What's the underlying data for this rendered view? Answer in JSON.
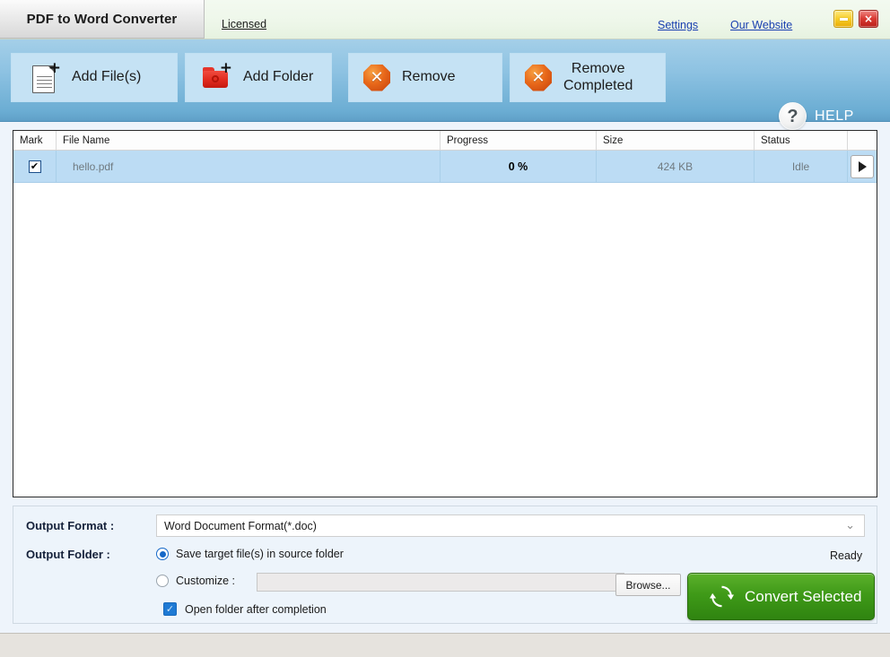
{
  "window": {
    "title": "PDF to Word Converter",
    "license_link": "Licensed",
    "settings_link": "Settings",
    "website_link": "Our Website",
    "minimize_glyph": "minimize-icon",
    "close_glyph": "×"
  },
  "toolbar": {
    "add_files": "Add File(s)",
    "add_folder": "Add Folder",
    "remove": "Remove",
    "remove_completed_line1": "Remove",
    "remove_completed_line2": "Completed",
    "help": "HELP",
    "help_glyph": "?",
    "plus_glyph": "+",
    "x_glyph": "✕"
  },
  "file_list": {
    "columns": [
      "Mark",
      "File Name",
      "Progress",
      "Size",
      "Status",
      ""
    ],
    "rows": [
      {
        "marked": true,
        "check_glyph": "✔",
        "file_name": "hello.pdf",
        "progress": "0 %",
        "size": "424 KB",
        "status": "Idle",
        "action": "play-icon"
      }
    ]
  },
  "options": {
    "format_label": "Output Format :",
    "format_value": "Word Document Format(*.doc)",
    "format_chevron": "⌄",
    "folder_label": "Output Folder :",
    "radio_source": "Save target file(s) in source folder",
    "radio_source_selected": true,
    "radio_custom": "Customize :",
    "radio_custom_selected": false,
    "custom_value": "",
    "browse": "Browse...",
    "open_folder": "Open folder after completion",
    "open_folder_checked": true,
    "open_folder_tick": "✓",
    "status": "Ready",
    "convert": "Convert Selected"
  },
  "colors": {
    "toolbar_blue": "#8dc2e2",
    "button_face": "#c5e2f4",
    "row_selected": "#bcdcf4",
    "convert_green": "#3f9a18",
    "accent_link": "#1a3fb0",
    "radio_blue": "#1668c8",
    "close_red": "#da3b34",
    "minimize_yellow": "#f8cf2a"
  }
}
